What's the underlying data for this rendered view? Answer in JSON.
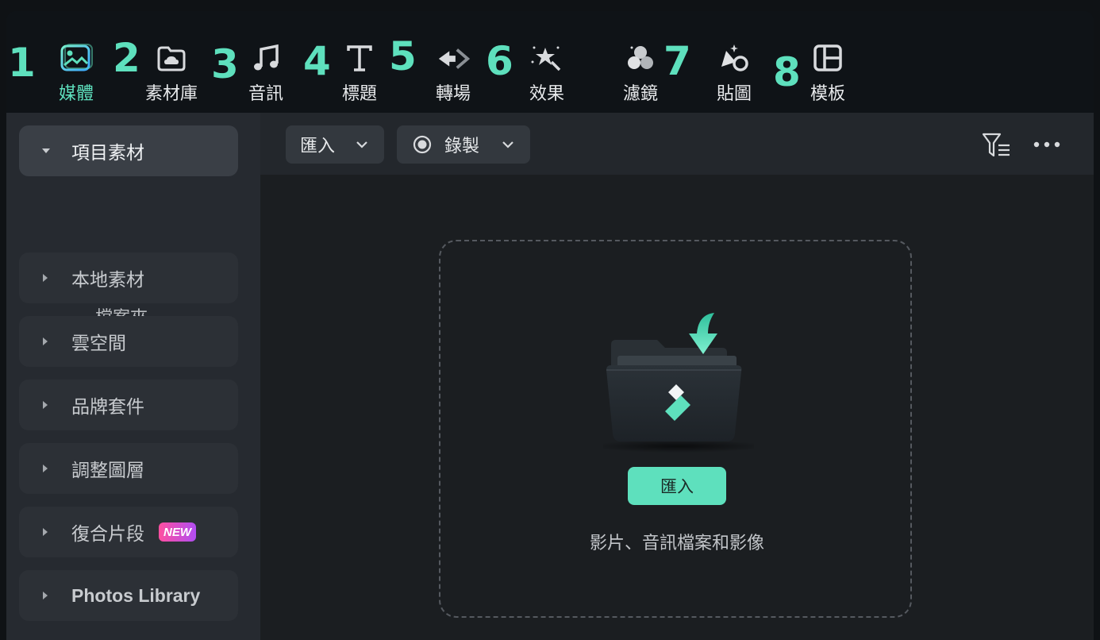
{
  "toolbar": {
    "steps": [
      "1",
      "2",
      "3",
      "4",
      "5",
      "6",
      "7",
      "8"
    ],
    "tabs": [
      {
        "label": "媒體",
        "icon": "media-icon",
        "active": true
      },
      {
        "label": "素材庫",
        "icon": "cloud-library-icon"
      },
      {
        "label": "音訊",
        "icon": "music-note-icon"
      },
      {
        "label": "標題",
        "icon": "text-title-icon"
      },
      {
        "label": "轉場",
        "icon": "transition-icon"
      },
      {
        "label": "效果",
        "icon": "effects-icon"
      },
      {
        "label": "濾鏡",
        "icon": "filters-icon"
      },
      {
        "label": "貼圖",
        "icon": "stickers-icon"
      },
      {
        "label": "模板",
        "icon": "templates-icon"
      }
    ]
  },
  "sidebar": {
    "project_media": "項目素材",
    "folder": "檔案夾",
    "items": [
      {
        "label": "本地素材"
      },
      {
        "label": "雲空間"
      },
      {
        "label": "品牌套件"
      },
      {
        "label": "調整圖層"
      },
      {
        "label": "復合片段",
        "badge": "NEW"
      },
      {
        "label": "Photos Library"
      }
    ]
  },
  "main": {
    "import_dropdown": "匯入",
    "record_dropdown": "錄製",
    "import_button": "匯入",
    "hint": "影片、音訊檔案和影像"
  },
  "colors": {
    "accent": "#5ee0bd",
    "toolbar_bg": "#0f1317",
    "sidebar_bg": "#262a30",
    "main_bg": "#1b1e21"
  }
}
